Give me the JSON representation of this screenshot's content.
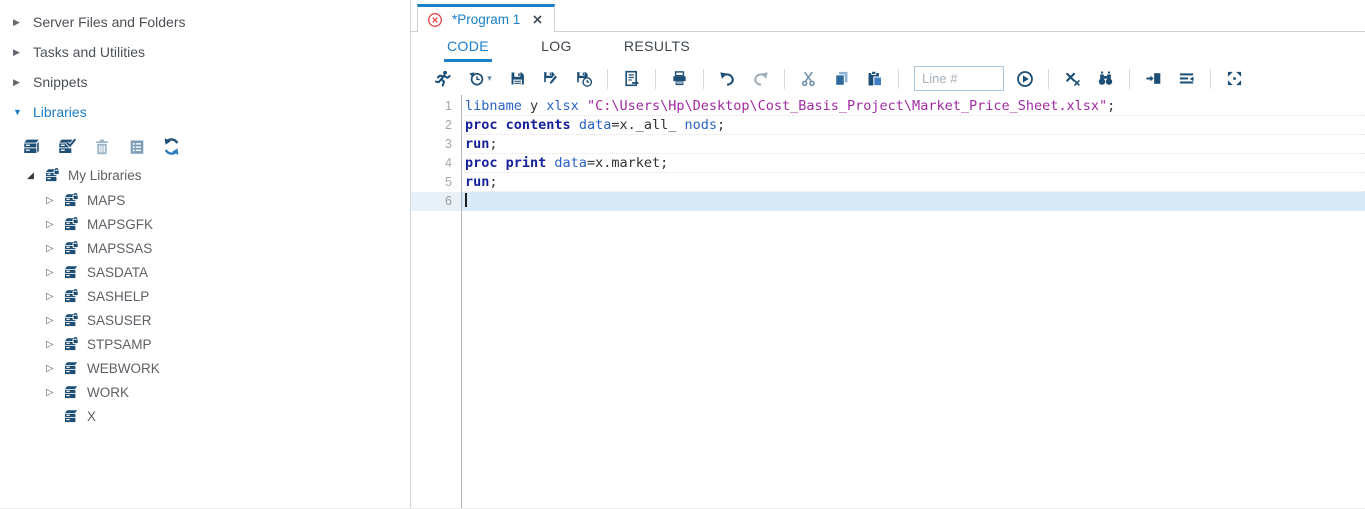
{
  "colors": {
    "accent_blue": "#1b7ec9",
    "icon_navy": "#1d4e75",
    "keyword_navy": "#16209a",
    "secondary_keyword_blue": "#2a63c4",
    "string_purple": "#a02ba2",
    "active_line_highlight": "#d8e9f8",
    "tab_close_red": "#e04444"
  },
  "sidebar": {
    "sections": [
      {
        "label": "Server Files and Folders",
        "expanded": false
      },
      {
        "label": "Tasks and Utilities",
        "expanded": false
      },
      {
        "label": "Snippets",
        "expanded": false
      },
      {
        "label": "Libraries",
        "expanded": true
      }
    ],
    "library_toolbar_icons": [
      "new-library-icon",
      "assign-library-icon",
      "delete-icon",
      "properties-icon",
      "refresh-icon"
    ],
    "tree": {
      "root": "My Libraries",
      "items": [
        {
          "label": "MAPS",
          "locked": true,
          "expandable": true
        },
        {
          "label": "MAPSGFK",
          "locked": true,
          "expandable": true
        },
        {
          "label": "MAPSSAS",
          "locked": true,
          "expandable": true
        },
        {
          "label": "SASDATA",
          "locked": false,
          "expandable": true
        },
        {
          "label": "SASHELP",
          "locked": true,
          "expandable": true
        },
        {
          "label": "SASUSER",
          "locked": true,
          "expandable": true
        },
        {
          "label": "STPSAMP",
          "locked": true,
          "expandable": true
        },
        {
          "label": "WEBWORK",
          "locked": false,
          "expandable": true
        },
        {
          "label": "WORK",
          "locked": false,
          "expandable": true
        },
        {
          "label": "X",
          "locked": false,
          "expandable": false
        }
      ]
    }
  },
  "editor_tab": {
    "title": "*Program 1",
    "modified": true
  },
  "view_tabs": [
    {
      "label": "CODE",
      "active": true
    },
    {
      "label": "LOG",
      "active": false
    },
    {
      "label": "RESULTS",
      "active": false
    }
  ],
  "editor_toolbar": {
    "icons": [
      "run-icon",
      "history-clock-icon",
      "chevron-down-icon",
      "save-icon",
      "save-as-icon",
      "save-history-icon",
      "document-submit-icon",
      "printer-icon",
      "undo-icon",
      "redo-icon",
      "scissors-icon",
      "copy-icon",
      "paste-icon",
      "goto-line-icon",
      "clear-code-icon",
      "find-replace-icon",
      "indent-code-icon",
      "format-code-icon",
      "maximize-view-icon"
    ],
    "line_input_placeholder": "Line #"
  },
  "code": {
    "lines": [
      {
        "num": "1",
        "active": false,
        "segs": [
          {
            "t": "fn",
            "x": "libname"
          },
          {
            "t": "pl",
            "x": " y "
          },
          {
            "t": "fn",
            "x": "xlsx"
          },
          {
            "t": "pl",
            "x": " "
          },
          {
            "t": "str",
            "x": "\"C:\\Users\\Hp\\Desktop\\Cost_Basis_Project\\Market_Price_Sheet.xlsx\""
          },
          {
            "t": "pl",
            "x": ";"
          }
        ]
      },
      {
        "num": "2",
        "active": false,
        "segs": [
          {
            "t": "kw",
            "x": "proc contents"
          },
          {
            "t": "pl",
            "x": " "
          },
          {
            "t": "fn",
            "x": "data"
          },
          {
            "t": "pl",
            "x": "=x._all_ "
          },
          {
            "t": "fn",
            "x": "nods"
          },
          {
            "t": "pl",
            "x": ";"
          }
        ]
      },
      {
        "num": "3",
        "active": false,
        "segs": [
          {
            "t": "kw",
            "x": "run"
          },
          {
            "t": "pl",
            "x": ";"
          }
        ]
      },
      {
        "num": "4",
        "active": false,
        "segs": [
          {
            "t": "kw",
            "x": "proc print"
          },
          {
            "t": "pl",
            "x": " "
          },
          {
            "t": "fn",
            "x": "data"
          },
          {
            "t": "pl",
            "x": "=x.market"
          },
          {
            "t": "pl",
            "x": ";"
          }
        ]
      },
      {
        "num": "5",
        "active": false,
        "segs": [
          {
            "t": "kw",
            "x": "run"
          },
          {
            "t": "pl",
            "x": ";"
          }
        ]
      },
      {
        "num": "6",
        "active": true,
        "segs": []
      }
    ]
  }
}
